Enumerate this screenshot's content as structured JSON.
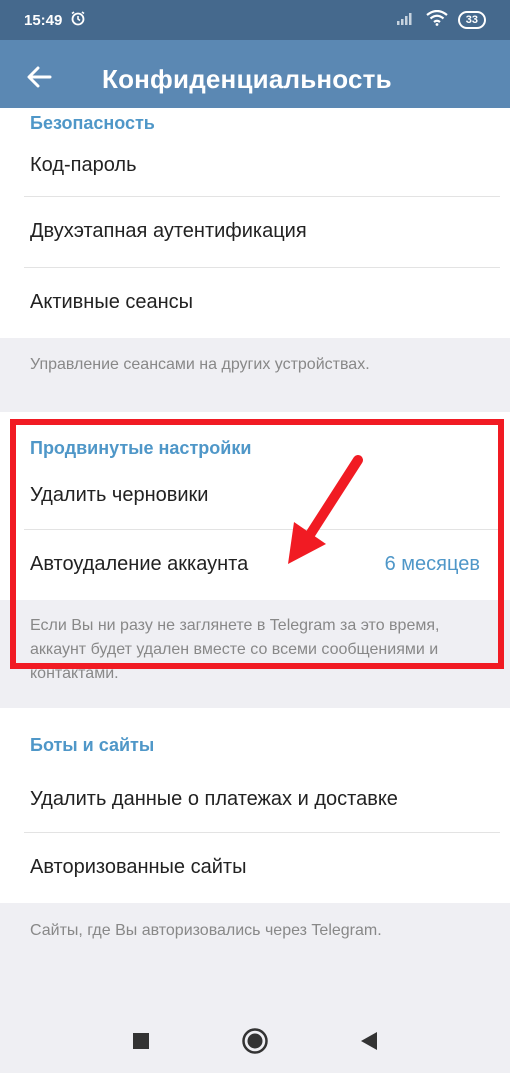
{
  "status_bar": {
    "time": "15:49",
    "battery": "33",
    "icons": [
      "alarm-icon",
      "signal-icon",
      "wifi-icon",
      "battery-icon"
    ]
  },
  "app_bar": {
    "title": "Конфиденциальность",
    "back_icon": "arrow-left-icon"
  },
  "security": {
    "header": "Безопасность",
    "items": [
      {
        "label": "Код-пароль"
      },
      {
        "label": "Двухэтапная аутентификация"
      },
      {
        "label": "Активные сеансы"
      }
    ],
    "note": "Управление сеансами на других устройствах."
  },
  "advanced": {
    "header": "Продвинутые настройки",
    "items": [
      {
        "label": "Удалить черновики"
      },
      {
        "label": "Автоудаление аккаунта",
        "value": "6 месяцев"
      }
    ],
    "note": "Если Вы ни разу не заглянете в Telegram за это время, аккаунт будет удален вместе со всеми сообщениями и контактами."
  },
  "bots": {
    "header": "Боты и сайты",
    "items": [
      {
        "label": "Удалить данные о платежах и доставке"
      },
      {
        "label": "Авторизованные сайты"
      }
    ],
    "note": "Сайты, где Вы авторизовались через Telegram."
  },
  "annotation": {
    "highlight_color": "#f11b23"
  },
  "colors": {
    "status_bar": "#45698d",
    "app_bar": "#5b88b3",
    "accent": "#4f97c8",
    "background": "#efeff3"
  },
  "nav_bar": {
    "icons": [
      "recents-square-icon",
      "home-circle-icon",
      "back-triangle-icon"
    ]
  }
}
